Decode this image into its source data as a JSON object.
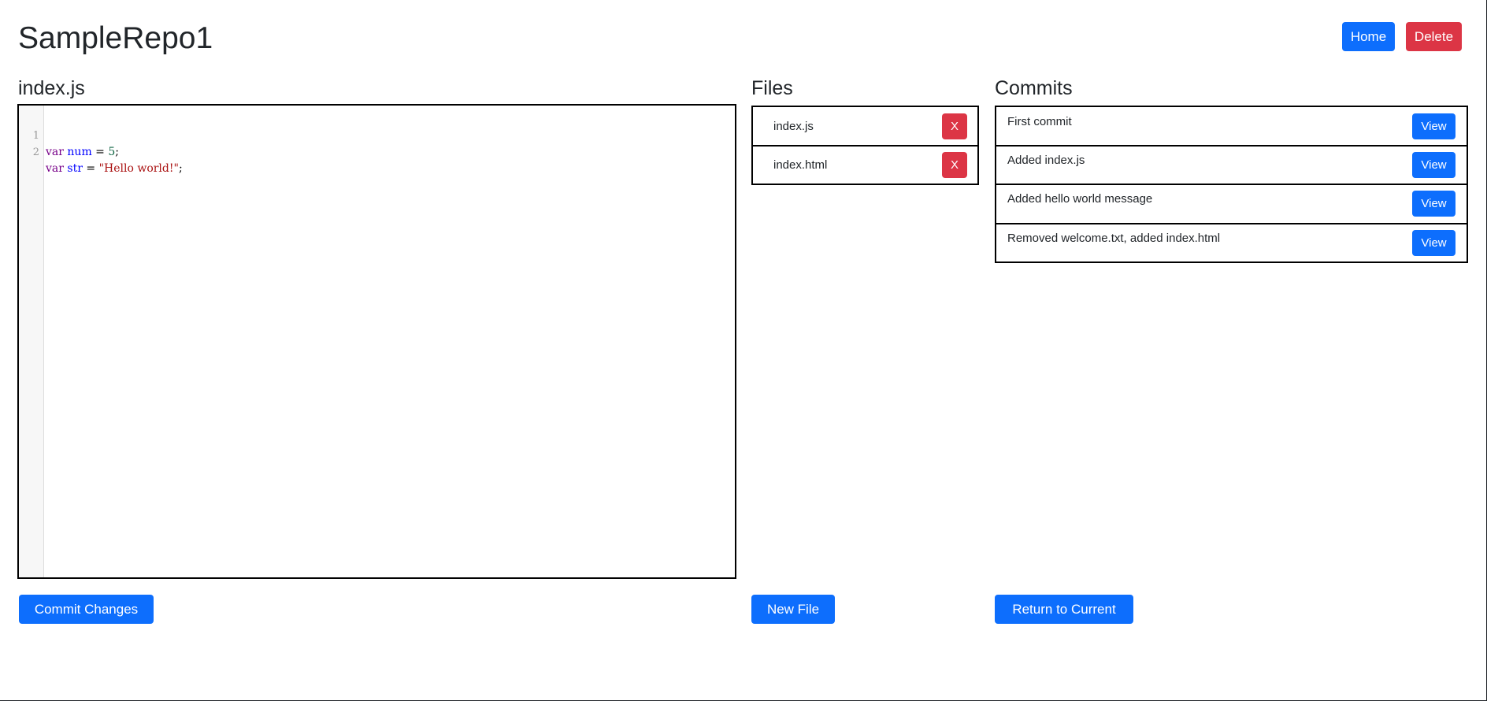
{
  "page": {
    "title": "SampleRepo1"
  },
  "header": {
    "home_label": "Home",
    "delete_label": "Delete"
  },
  "editor": {
    "heading": "index.js",
    "lines": [
      {
        "number": "1",
        "tokens": [
          "var",
          " ",
          "num",
          " = ",
          "5",
          ";"
        ]
      },
      {
        "number": "2",
        "tokens": [
          "var",
          " ",
          "str",
          " = ",
          "\"Hello world!\"",
          ";"
        ]
      }
    ],
    "commit_label": "Commit Changes"
  },
  "files": {
    "heading": "Files",
    "items": [
      {
        "name": "index.js",
        "remove_label": "X"
      },
      {
        "name": "index.html",
        "remove_label": "X"
      }
    ],
    "new_label": "New File"
  },
  "commits": {
    "heading": "Commits",
    "items": [
      {
        "message": "First commit",
        "view_label": "View"
      },
      {
        "message": "Added index.js",
        "view_label": "View"
      },
      {
        "message": "Added hello world message",
        "view_label": "View"
      },
      {
        "message": "Removed welcome.txt, added index.html",
        "view_label": "View"
      }
    ],
    "return_label": "Return to Current"
  },
  "colors": {
    "primary": "#0d6efd",
    "danger": "#dc3545"
  }
}
